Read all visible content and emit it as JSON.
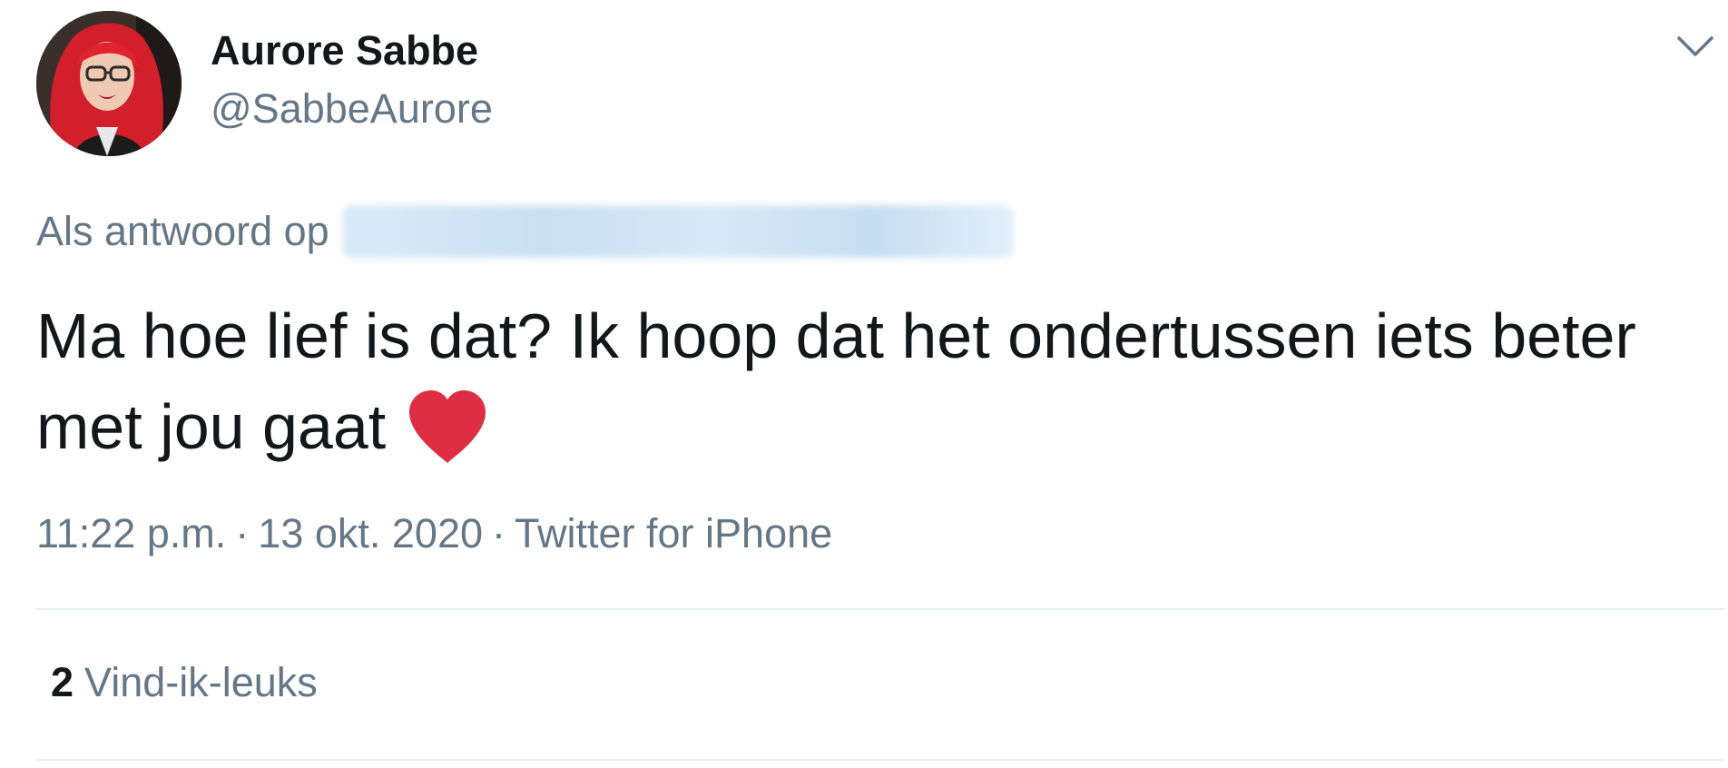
{
  "user": {
    "display_name": "Aurore Sabbe",
    "handle": "@SabbeAurore",
    "avatar_icon": "profile-photo"
  },
  "reply": {
    "prefix": "Als antwoord op"
  },
  "tweet": {
    "text": "Ma hoe lief is dat? Ik hoop dat het ondertussen iets beter met jou gaat",
    "emoji_icon": "red-heart-icon"
  },
  "meta": {
    "time": "11:22 p.m.",
    "separator": "·",
    "date": "13 okt. 2020",
    "source": "Twitter for iPhone"
  },
  "stats": {
    "likes_count": "2",
    "likes_label": "Vind-ik-leuks"
  },
  "colors": {
    "text_primary": "#14171a",
    "text_secondary": "#657786",
    "divider": "#e6ecf0",
    "heart": "#dd2e44"
  }
}
